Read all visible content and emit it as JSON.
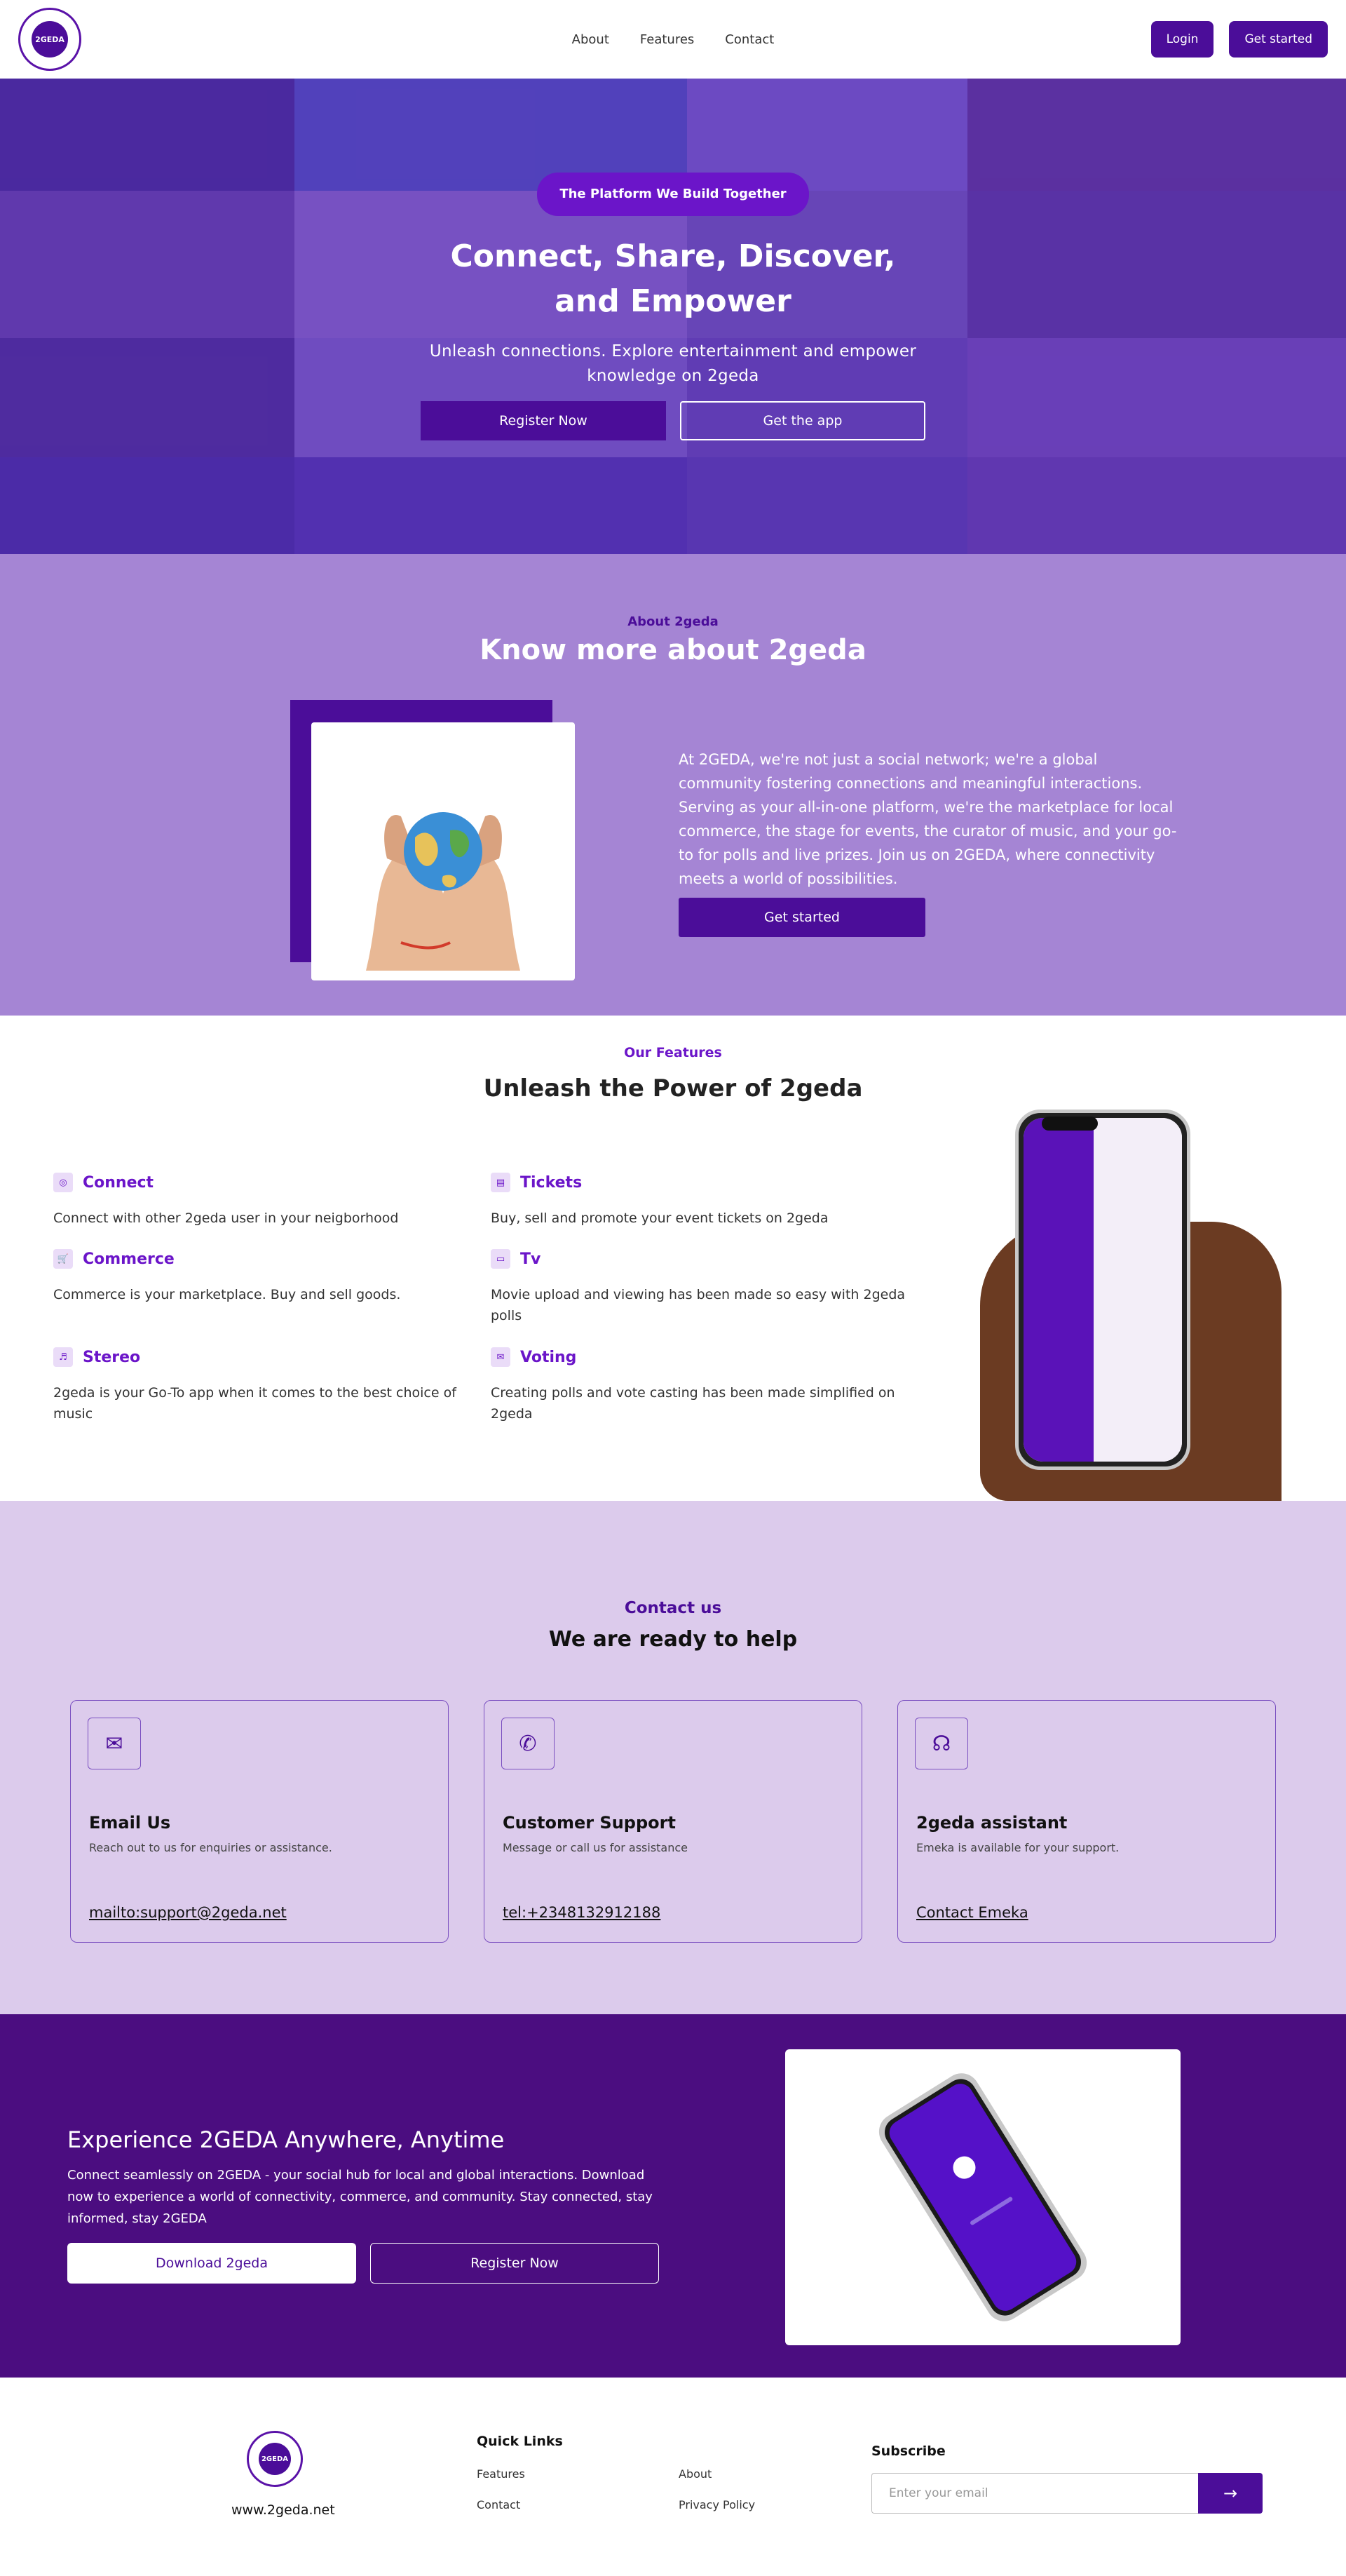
{
  "brand": {
    "logo_text": "2GEDA",
    "primary": "#4b0d99",
    "accent": "#6b15c9"
  },
  "nav": {
    "links": [
      "About",
      "Features",
      "Contact"
    ],
    "login_label": "Login",
    "get_started_label": "Get started"
  },
  "hero": {
    "pill": "The Platform We Build Together",
    "title_line1": "Connect, Share, Discover,",
    "title_line2": "and Empower",
    "subtitle": "Unleash connections. Explore entertainment and empower knowledge on 2geda",
    "register_label": "Register Now",
    "get_app_label": "Get the app"
  },
  "about": {
    "kicker": "About 2geda",
    "title": "Know more about 2geda",
    "body": "At 2GEDA, we're not just a social network; we're a global community fostering connections and meaningful interactions. Serving as your all-in-one platform, we're the marketplace for local commerce, the stage for events, the curator of music, and your go-to for polls and live prizes. Join us on 2GEDA, where connectivity meets a world of possibilities.",
    "button_label": "Get started"
  },
  "features": {
    "kicker": "Our Features",
    "title": "Unleash the Power of 2geda",
    "items": [
      {
        "name": "Connect",
        "icon": "connect-icon",
        "glyph": "◎",
        "desc": "Connect with other 2geda user in your neigborhood"
      },
      {
        "name": "Tickets",
        "icon": "ticket-icon",
        "glyph": "▤",
        "desc": "Buy, sell and promote your event tickets on 2geda"
      },
      {
        "name": "Commerce",
        "icon": "cart-icon",
        "glyph": "🛒",
        "desc": "Commerce is your marketplace. Buy and sell goods."
      },
      {
        "name": "Tv",
        "icon": "tv-icon",
        "glyph": "▭",
        "desc": "Movie upload and viewing has been made so easy with 2geda polls"
      },
      {
        "name": "Stereo",
        "icon": "music-note-icon",
        "glyph": "♬",
        "desc": "2geda is your Go-To app when it comes to the best choice of music"
      },
      {
        "name": "Voting",
        "icon": "voting-icon",
        "glyph": "✉",
        "desc": "Creating polls and vote casting has been made simplified on 2geda"
      }
    ]
  },
  "contact": {
    "kicker": "Contact us",
    "title": "We are ready to help",
    "cards": [
      {
        "icon": "envelope-icon",
        "glyph": "✉",
        "title": "Email Us",
        "desc": "Reach out to us for enquiries or assistance.",
        "link": "mailto:support@2geda.net"
      },
      {
        "icon": "phone-icon",
        "glyph": "✆",
        "title": "Customer Support",
        "desc": "Message or call us for assistance",
        "link": "tel:+2348132912188"
      },
      {
        "icon": "headset-icon",
        "glyph": "☊",
        "title": "2geda assistant",
        "desc": "Emeka is available for your support.",
        "link": "Contact Emeka"
      }
    ]
  },
  "experience": {
    "title": "Experience 2GEDA Anywhere, Anytime",
    "body": "Connect seamlessly on 2GEDA - your social hub for local and global interactions. Download now to experience a world of connectivity, commerce, and community. Stay connected, stay informed, stay 2GEDA",
    "download_label": "Download 2geda",
    "register_label": "Register Now"
  },
  "footer": {
    "site": "www.2geda.net",
    "quick_links_title": "Quick Links",
    "links": [
      "Features",
      "About",
      "Contact",
      "Privacy Policy"
    ],
    "subscribe_title": "Subscribe",
    "email_placeholder": "Enter your email",
    "submit_glyph": "→"
  }
}
